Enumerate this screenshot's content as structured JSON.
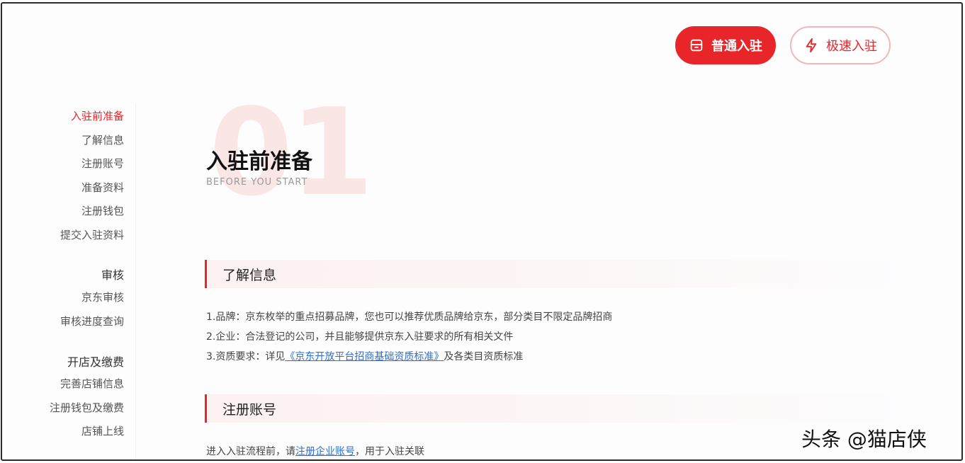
{
  "buttons": {
    "normal": "普通入驻",
    "fast": "极速入驻"
  },
  "sidebar": {
    "items": [
      {
        "label": "入驻前准备",
        "active": true
      },
      {
        "label": "了解信息"
      },
      {
        "label": "注册账号"
      },
      {
        "label": "准备资料"
      },
      {
        "label": "注册钱包"
      },
      {
        "label": "提交入驻资料"
      },
      {
        "label": "审核",
        "group": true
      },
      {
        "label": "京东审核"
      },
      {
        "label": "审核进度查询"
      },
      {
        "label": "开店及缴费",
        "group": true
      },
      {
        "label": "完善店铺信息"
      },
      {
        "label": "注册钱包及缴费"
      },
      {
        "label": "店铺上线"
      }
    ]
  },
  "header": {
    "number": "01",
    "title": "入驻前准备",
    "subtitle": "BEFORE YOU START"
  },
  "sections": {
    "info": {
      "title": "了解信息",
      "line1": "1.品牌：京东枚举的重点招募品牌，您也可以推荐优质品牌给京东，部分类目不限定品牌招商",
      "line2": "2.企业：合法登记的公司，并且能够提供京东入驻要求的所有相关文件",
      "line3_prefix": "3.资质要求：详见",
      "line3_link": "《京东开放平台招商基础资质标准》",
      "line3_suffix": "及各类目资质标准"
    },
    "register": {
      "title": "注册账号",
      "line_prefix": "进入入驻流程前，请",
      "line_link": "注册企业账号",
      "line_suffix": "，用于入驻关联"
    }
  },
  "watermark": "头条 @猫店侠",
  "colors": {
    "accent": "#e8262a",
    "link": "#2e6fd0"
  }
}
